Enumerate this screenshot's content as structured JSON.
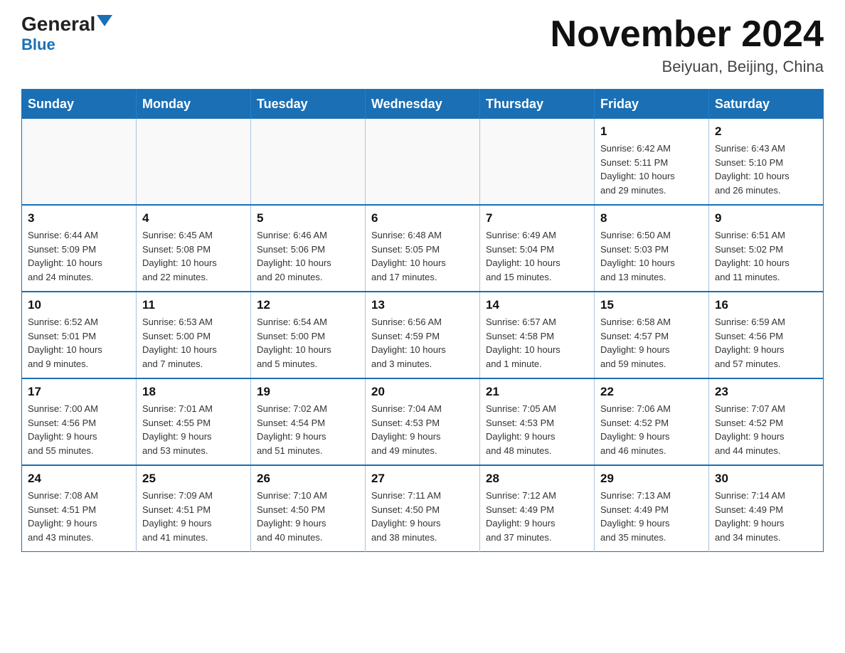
{
  "header": {
    "logo_part1": "General",
    "logo_part2": "Blue",
    "month_title": "November 2024",
    "location": "Beiyuan, Beijing, China"
  },
  "weekdays": [
    "Sunday",
    "Monday",
    "Tuesday",
    "Wednesday",
    "Thursday",
    "Friday",
    "Saturday"
  ],
  "weeks": [
    [
      {
        "day": "",
        "info": ""
      },
      {
        "day": "",
        "info": ""
      },
      {
        "day": "",
        "info": ""
      },
      {
        "day": "",
        "info": ""
      },
      {
        "day": "",
        "info": ""
      },
      {
        "day": "1",
        "info": "Sunrise: 6:42 AM\nSunset: 5:11 PM\nDaylight: 10 hours\nand 29 minutes."
      },
      {
        "day": "2",
        "info": "Sunrise: 6:43 AM\nSunset: 5:10 PM\nDaylight: 10 hours\nand 26 minutes."
      }
    ],
    [
      {
        "day": "3",
        "info": "Sunrise: 6:44 AM\nSunset: 5:09 PM\nDaylight: 10 hours\nand 24 minutes."
      },
      {
        "day": "4",
        "info": "Sunrise: 6:45 AM\nSunset: 5:08 PM\nDaylight: 10 hours\nand 22 minutes."
      },
      {
        "day": "5",
        "info": "Sunrise: 6:46 AM\nSunset: 5:06 PM\nDaylight: 10 hours\nand 20 minutes."
      },
      {
        "day": "6",
        "info": "Sunrise: 6:48 AM\nSunset: 5:05 PM\nDaylight: 10 hours\nand 17 minutes."
      },
      {
        "day": "7",
        "info": "Sunrise: 6:49 AM\nSunset: 5:04 PM\nDaylight: 10 hours\nand 15 minutes."
      },
      {
        "day": "8",
        "info": "Sunrise: 6:50 AM\nSunset: 5:03 PM\nDaylight: 10 hours\nand 13 minutes."
      },
      {
        "day": "9",
        "info": "Sunrise: 6:51 AM\nSunset: 5:02 PM\nDaylight: 10 hours\nand 11 minutes."
      }
    ],
    [
      {
        "day": "10",
        "info": "Sunrise: 6:52 AM\nSunset: 5:01 PM\nDaylight: 10 hours\nand 9 minutes."
      },
      {
        "day": "11",
        "info": "Sunrise: 6:53 AM\nSunset: 5:00 PM\nDaylight: 10 hours\nand 7 minutes."
      },
      {
        "day": "12",
        "info": "Sunrise: 6:54 AM\nSunset: 5:00 PM\nDaylight: 10 hours\nand 5 minutes."
      },
      {
        "day": "13",
        "info": "Sunrise: 6:56 AM\nSunset: 4:59 PM\nDaylight: 10 hours\nand 3 minutes."
      },
      {
        "day": "14",
        "info": "Sunrise: 6:57 AM\nSunset: 4:58 PM\nDaylight: 10 hours\nand 1 minute."
      },
      {
        "day": "15",
        "info": "Sunrise: 6:58 AM\nSunset: 4:57 PM\nDaylight: 9 hours\nand 59 minutes."
      },
      {
        "day": "16",
        "info": "Sunrise: 6:59 AM\nSunset: 4:56 PM\nDaylight: 9 hours\nand 57 minutes."
      }
    ],
    [
      {
        "day": "17",
        "info": "Sunrise: 7:00 AM\nSunset: 4:56 PM\nDaylight: 9 hours\nand 55 minutes."
      },
      {
        "day": "18",
        "info": "Sunrise: 7:01 AM\nSunset: 4:55 PM\nDaylight: 9 hours\nand 53 minutes."
      },
      {
        "day": "19",
        "info": "Sunrise: 7:02 AM\nSunset: 4:54 PM\nDaylight: 9 hours\nand 51 minutes."
      },
      {
        "day": "20",
        "info": "Sunrise: 7:04 AM\nSunset: 4:53 PM\nDaylight: 9 hours\nand 49 minutes."
      },
      {
        "day": "21",
        "info": "Sunrise: 7:05 AM\nSunset: 4:53 PM\nDaylight: 9 hours\nand 48 minutes."
      },
      {
        "day": "22",
        "info": "Sunrise: 7:06 AM\nSunset: 4:52 PM\nDaylight: 9 hours\nand 46 minutes."
      },
      {
        "day": "23",
        "info": "Sunrise: 7:07 AM\nSunset: 4:52 PM\nDaylight: 9 hours\nand 44 minutes."
      }
    ],
    [
      {
        "day": "24",
        "info": "Sunrise: 7:08 AM\nSunset: 4:51 PM\nDaylight: 9 hours\nand 43 minutes."
      },
      {
        "day": "25",
        "info": "Sunrise: 7:09 AM\nSunset: 4:51 PM\nDaylight: 9 hours\nand 41 minutes."
      },
      {
        "day": "26",
        "info": "Sunrise: 7:10 AM\nSunset: 4:50 PM\nDaylight: 9 hours\nand 40 minutes."
      },
      {
        "day": "27",
        "info": "Sunrise: 7:11 AM\nSunset: 4:50 PM\nDaylight: 9 hours\nand 38 minutes."
      },
      {
        "day": "28",
        "info": "Sunrise: 7:12 AM\nSunset: 4:49 PM\nDaylight: 9 hours\nand 37 minutes."
      },
      {
        "day": "29",
        "info": "Sunrise: 7:13 AM\nSunset: 4:49 PM\nDaylight: 9 hours\nand 35 minutes."
      },
      {
        "day": "30",
        "info": "Sunrise: 7:14 AM\nSunset: 4:49 PM\nDaylight: 9 hours\nand 34 minutes."
      }
    ]
  ]
}
